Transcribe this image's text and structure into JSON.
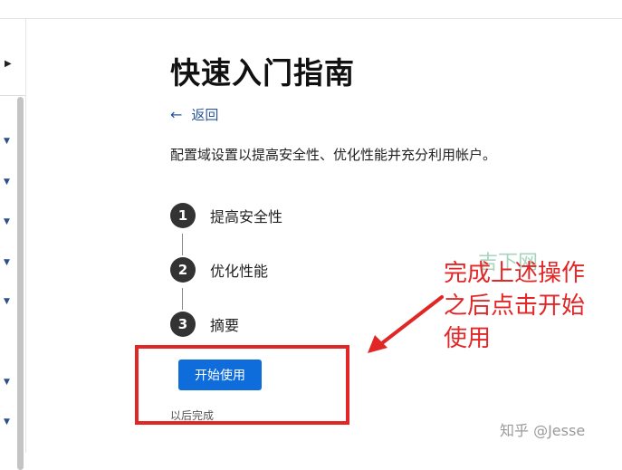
{
  "page": {
    "title": "快速入门指南",
    "back_label": "返回",
    "description": "配置域设置以提高安全性、优化性能并充分利用帐户。"
  },
  "steps": [
    {
      "number": "1",
      "label": "提高安全性"
    },
    {
      "number": "2",
      "label": "优化性能"
    },
    {
      "number": "3",
      "label": "摘要"
    }
  ],
  "actions": {
    "start_label": "开始使用",
    "later_label": "以后完成"
  },
  "annotation": {
    "text_lines": [
      "完成上述操作",
      "之后点击开始",
      "使用"
    ]
  },
  "watermarks": {
    "site_mark": "吉下网",
    "source": "知乎 @Jesse"
  },
  "icons": {
    "back": "arrow-left-icon",
    "rail_expand": "chevron-right-icon",
    "rail_items": "chevron-down-icon"
  },
  "colors": {
    "primary_button": "#0f6cdb",
    "link": "#2b579a",
    "annotation_red": "#e12626",
    "step_circle": "#333333"
  }
}
